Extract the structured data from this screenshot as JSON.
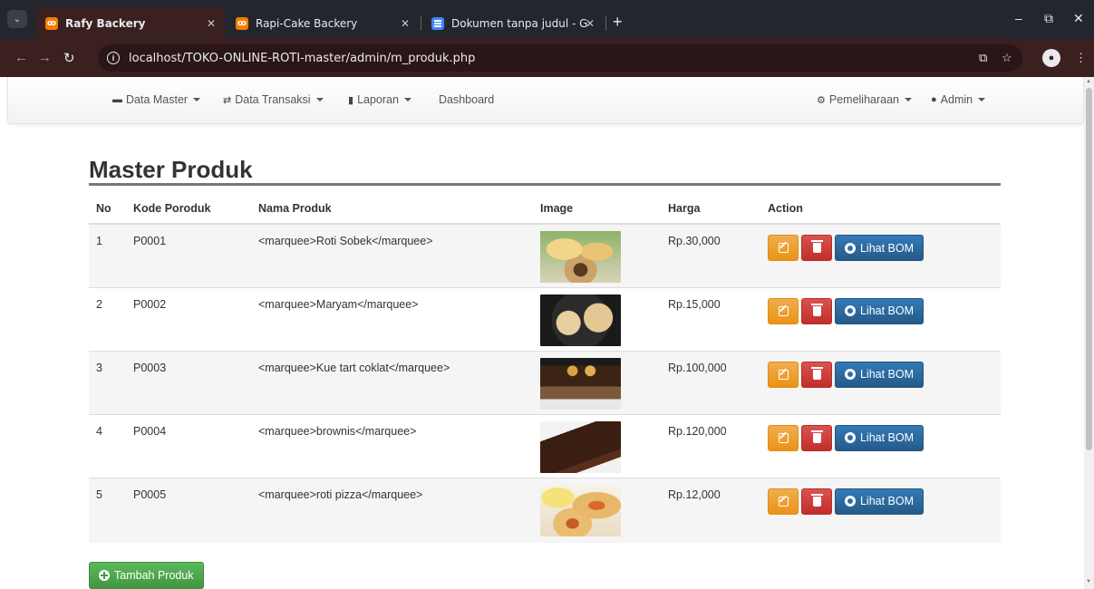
{
  "browser": {
    "tabs": [
      {
        "title": "Rafy Backery",
        "active": true
      },
      {
        "title": "Rapi-Cake Backery",
        "active": false
      },
      {
        "title": "Dokumen tanpa judul - Google",
        "active": false
      }
    ],
    "url": "localhost/TOKO-ONLINE-ROTI-master/admin/m_produk.php",
    "icons": [
      "tab-menu-icon",
      "back-icon",
      "forward-icon",
      "reload-icon",
      "info-icon",
      "translate-icon",
      "star-icon",
      "profile-icon",
      "kebab-menu-icon",
      "minimize-icon",
      "maximize-icon",
      "close-icon"
    ]
  },
  "navbar": {
    "left": [
      {
        "label": "Data Master",
        "icon": "folder-icon",
        "dropdown": true
      },
      {
        "label": "Data Transaksi",
        "icon": "retweet-icon",
        "dropdown": true
      },
      {
        "label": "Laporan",
        "icon": "bar-chart-icon",
        "dropdown": true
      },
      {
        "label": "Dashboard",
        "icon": "",
        "dropdown": false
      }
    ],
    "right": [
      {
        "label": "Pemeliharaan",
        "icon": "cog-icon",
        "dropdown": true
      },
      {
        "label": "Admin",
        "icon": "user-icon",
        "dropdown": true
      }
    ]
  },
  "page": {
    "title": "Master Produk",
    "add_button": "Tambah Produk"
  },
  "table": {
    "headers": [
      "No",
      "Kode Poroduk",
      "Nama Produk",
      "Image",
      "Harga",
      "Action"
    ],
    "rows": [
      {
        "no": "1",
        "kode": "P0001",
        "nama": "<marquee>Roti Sobek</marquee>",
        "harga": "Rp.30,000"
      },
      {
        "no": "2",
        "kode": "P0002",
        "nama": "<marquee>Maryam</marquee>",
        "harga": "Rp.15,000"
      },
      {
        "no": "3",
        "kode": "P0003",
        "nama": "<marquee>Kue tart coklat</marquee>",
        "harga": "Rp.100,000"
      },
      {
        "no": "4",
        "kode": "P0004",
        "nama": "<marquee>brownis</marquee>",
        "harga": "Rp.120,000"
      },
      {
        "no": "5",
        "kode": "P0005",
        "nama": "<marquee>roti pizza</marquee>",
        "harga": "Rp.12,000"
      }
    ],
    "action_label": "Lihat BOM"
  },
  "colors": {
    "warning": "#f0ad4e",
    "danger": "#d9534f",
    "primary": "#337ab7",
    "success": "#5cb85c",
    "chrome_bar": "#3b2020"
  }
}
